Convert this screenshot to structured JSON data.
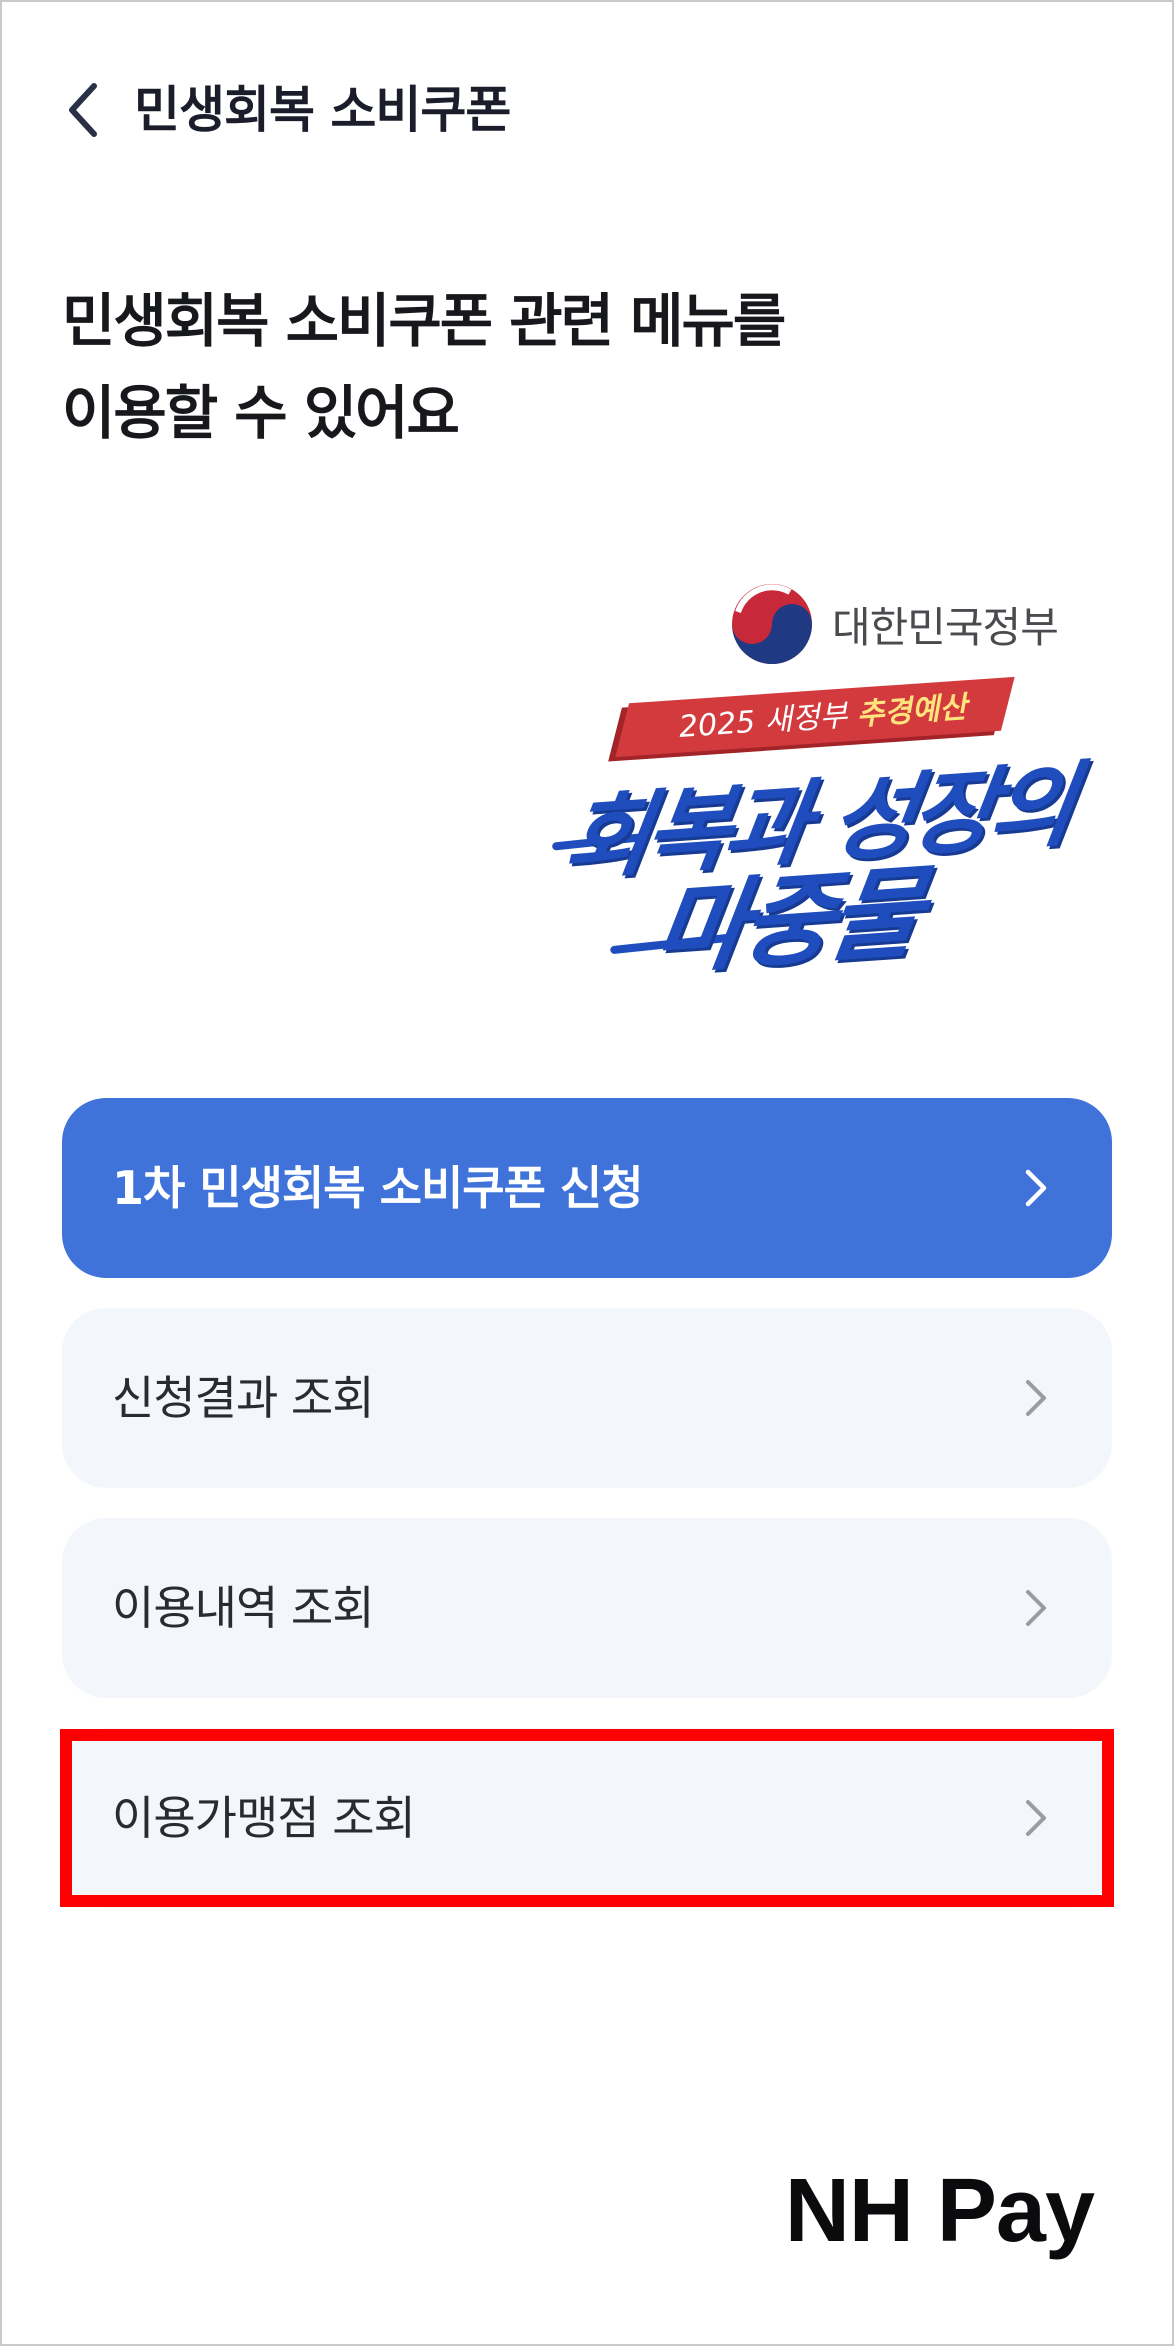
{
  "header": {
    "title": "민생회복 소비쿠폰",
    "back_icon": "chevron-left-icon"
  },
  "headline": {
    "line1": "민생회복 소비쿠폰 관련 메뉴를",
    "line2": "이용할 수 있어요"
  },
  "gov_logo": {
    "text": "대한민국정부",
    "emblem_icon": "taegeuk-emblem-icon"
  },
  "banner": {
    "ribbon_prefix": "2025 새정부 ",
    "ribbon_highlight": "추경예산",
    "slogan_line1": "회복과 성장의",
    "slogan_line2": "마중물"
  },
  "menu": [
    {
      "label": "1차 민생회복 소비쿠폰 신청",
      "style": "primary"
    },
    {
      "label": "신청결과 조회",
      "style": "secondary"
    },
    {
      "label": "이용내역 조회",
      "style": "secondary"
    },
    {
      "label": "이용가맹점 조회",
      "style": "secondary",
      "highlighted": true
    }
  ],
  "brand": {
    "text": "NH Pay"
  },
  "colors": {
    "primary_button": "#3f73d9",
    "secondary_button": "#f3f6fb",
    "highlight_border": "#ff0000",
    "slogan_blue": "#1f4dbd",
    "ribbon_red": "#d23a3e"
  }
}
